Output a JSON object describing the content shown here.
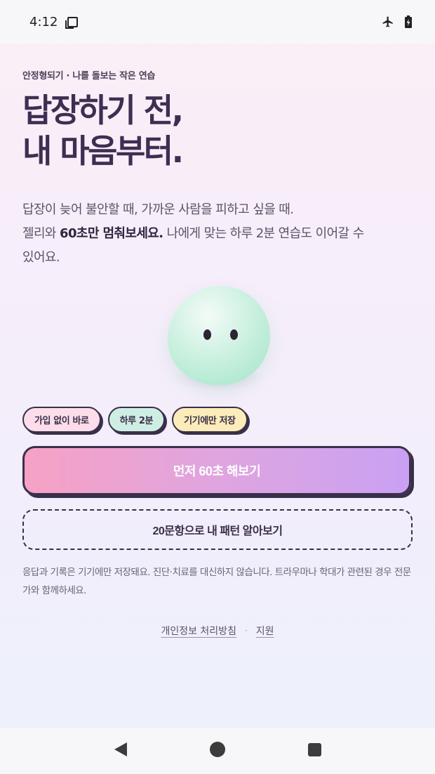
{
  "status_bar": {
    "time": "4:12"
  },
  "kicker": "안정형되기 · 나를 돌보는 작은 연습",
  "headline": {
    "line1": "답장하기 전,",
    "line2": "내 마음부터."
  },
  "description": {
    "line1": "답장이 늦어 불안할 때, 가까운 사람을 피하고 싶을 때.",
    "line2_prefix": "젤리와 ",
    "line2_bold": "60초만 멈춰보세요.",
    "line2_suffix": " 나에게 맞는 하루 2분 연습도 이어갈 수",
    "line3": "있어요."
  },
  "chips": [
    "가입 없이 바로",
    "하루 2분",
    "기기에만 저장"
  ],
  "primary_button": "먼저 60초 해보기",
  "secondary_button": "20문항으로 내 패턴 알아보기",
  "disclaimer": "응답과 기록은 기기에만 저장돼요. 진단·치료를 대신하지 않습니다. 트라우마나 학대가 관련된 경우 전문가와 함께하세요.",
  "footer": {
    "privacy": "개인정보 처리방침",
    "separator": "·",
    "support": "지원"
  },
  "colors": {
    "ink": "#3a2f4a",
    "accent_pink": "#f7a1c5",
    "accent_purple": "#c9a1f3",
    "jelly_mint": "#b8ebd5"
  }
}
